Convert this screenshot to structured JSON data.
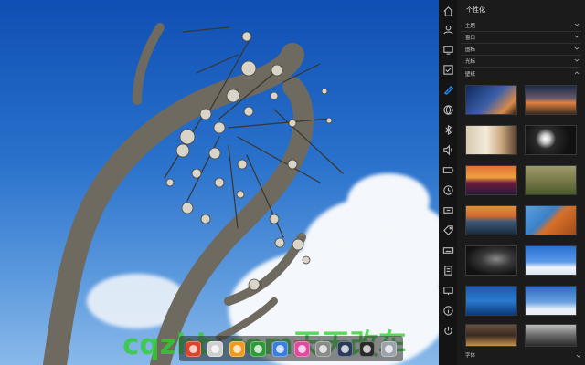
{
  "watermark": "cqzhb.com天天改车",
  "panel": {
    "title": "个性化",
    "sections": [
      {
        "label": "主题",
        "state": "collapsed"
      },
      {
        "label": "窗口",
        "state": "collapsed"
      },
      {
        "label": "图标",
        "state": "collapsed"
      },
      {
        "label": "光标",
        "state": "collapsed"
      },
      {
        "label": "壁纸",
        "state": "expanded"
      }
    ],
    "bottom_section": {
      "label": "字体"
    },
    "rail_icons": [
      "home-icon",
      "account-icon",
      "display-icon",
      "checkbox-icon",
      "personalization-icon",
      "network-icon",
      "bluetooth-icon",
      "sound-icon",
      "battery-icon",
      "time-icon",
      "shortcut-icon",
      "tag-icon",
      "keyboard-icon",
      "power-icon",
      "monitor-icon",
      "info-icon",
      "shutdown-icon"
    ],
    "wallpapers": [
      "night-city-street",
      "rocky-coast-sunset",
      "room-interior",
      "flowers-dark",
      "bridge-sunset",
      "green-hills",
      "lake-sunset",
      "orange-rock-arch",
      "dark-abstract-light",
      "blue-sky-clouds",
      "seagulls-blue-sea",
      "tree-sky-silhouette",
      "asian-architecture",
      "black-white-building"
    ]
  },
  "dock": {
    "items": [
      "launcher-icon",
      "file-manager-icon",
      "browser-icon",
      "music-icon",
      "chrome-icon",
      "video-icon",
      "settings-icon",
      "app-store-icon",
      "terminal-icon",
      "trash-icon"
    ]
  },
  "colors": {
    "accent": "#1e8fff",
    "panel_bg": "#1b1b1b",
    "watermark": "#2fcf2f"
  }
}
